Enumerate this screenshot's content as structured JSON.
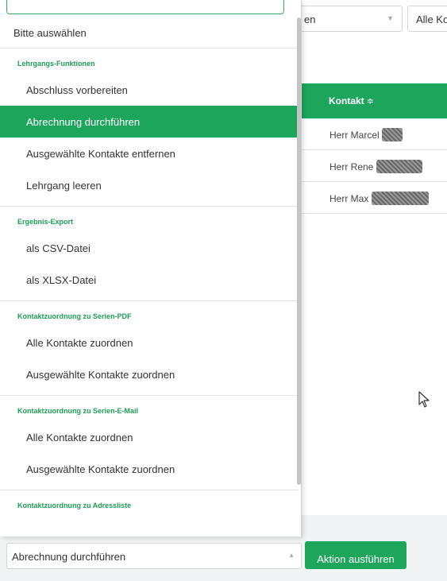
{
  "filters": {
    "select_1_value": "en",
    "select_2_value": "Alle Ko"
  },
  "table": {
    "header": "Kontakt",
    "sort_icon": "sort-updown-icon",
    "rows": [
      {
        "name": "Herr Marcel"
      },
      {
        "name": "Herr Rene"
      },
      {
        "name": "Herr Max"
      }
    ]
  },
  "dropdown": {
    "placeholder": "Bitte auswählen",
    "groups": [
      {
        "title": "Lehrgangs-Funktionen",
        "items": [
          "Abschluss vorbereiten",
          "Abrechnung durchführen",
          "Ausgewählte Kontakte entfernen",
          "Lehrgang leeren"
        ]
      },
      {
        "title": "Ergebnis-Export",
        "items": [
          "als CSV-Datei",
          "als XLSX-Datei"
        ]
      },
      {
        "title": "Kontaktzuordnung zu Serien-PDF",
        "items": [
          "Alle Kontakte zuordnen",
          "Ausgewählte Kontakte zuordnen"
        ]
      },
      {
        "title": "Kontaktzuordnung zu Serien-E-Mail",
        "items": [
          "Alle Kontakte zuordnen",
          "Ausgewählte Kontakte zuordnen"
        ]
      },
      {
        "title": "Kontaktzuordnung zu Adressliste",
        "items": []
      }
    ]
  },
  "action_bar": {
    "selected_value": "Abrechnung durchführen",
    "button_label": "Aktion ausführen"
  },
  "colors": {
    "accent": "#1ea55c",
    "group_title": "#1e9e56"
  }
}
